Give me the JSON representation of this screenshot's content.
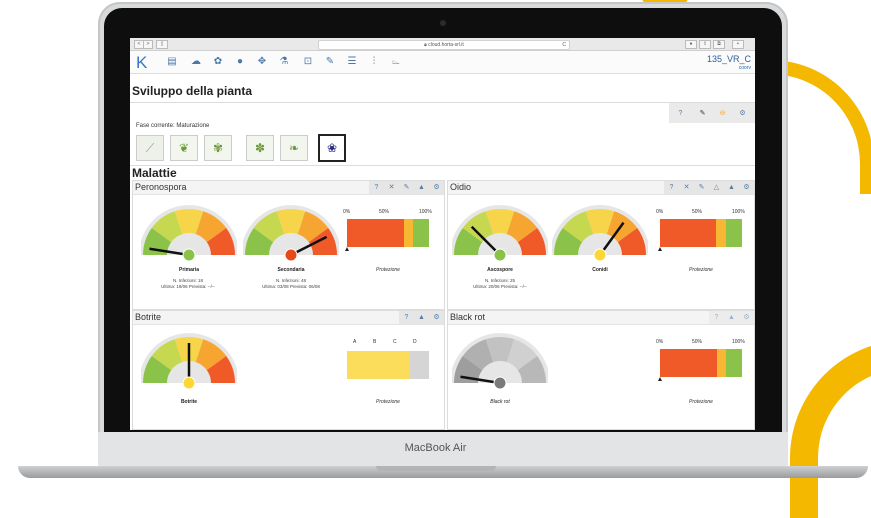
{
  "device": {
    "brand": "MacBook Air"
  },
  "browser": {
    "url": "cloud.horta-srl.it",
    "nav_back": "<",
    "nav_forward": ">",
    "sidebar": "▯",
    "reload": "C",
    "right_icons": [
      "●",
      "⇪",
      "⧉",
      "+"
    ]
  },
  "app": {
    "logo": "K",
    "title": "135_VR_C",
    "subtitle": "coorv",
    "nav_icons": [
      "document-icon",
      "cloud-icon",
      "leaf-icon",
      "bug-icon",
      "tree-icon",
      "flask-icon",
      "target-icon",
      "edit-icon",
      "list-icon",
      "sliders-icon",
      "chart-icon"
    ]
  },
  "development": {
    "title": "Sviluppo della pianta",
    "current_phase_label": "Fase corrente: Maturazione",
    "tools": [
      "?",
      "✎",
      "⊖",
      "⚙"
    ],
    "phases": [
      "bud-icon",
      "sprout-icon",
      "leaves-icon",
      "flower-icon",
      "fruitset-icon",
      "grape-icon"
    ]
  },
  "diseases": {
    "title": "Malattie",
    "peronospora": {
      "name": "Peronospora",
      "tools": [
        "?",
        "✕",
        "✎",
        "▲",
        "⚙"
      ],
      "gauges": [
        {
          "label": "Primaria",
          "level": 0.05,
          "dot": "#8bc34a",
          "info": [
            "N. Infezioni: 18",
            "Ultima: 19/06 Prevista: --/--"
          ]
        },
        {
          "label": "Secondaria",
          "level": 0.85,
          "dot": "#e64a19",
          "info": [
            "N. Infezioni: 48",
            "Ultima: 03/08 Prevista: 06/08"
          ]
        }
      ],
      "protection": {
        "ticks": [
          "0%",
          "50%",
          "100%"
        ],
        "label": "Protezione",
        "segments": [
          {
            "color": "#f05a28",
            "value": 0.7
          },
          {
            "color": "#f7b733",
            "value": 0.1
          },
          {
            "color": "#8bc34a",
            "value": 0.2
          }
        ]
      }
    },
    "oidio": {
      "name": "Oidio",
      "tools": [
        "?",
        "✕",
        "✎",
        "△",
        "▲",
        "⚙"
      ],
      "gauges": [
        {
          "label": "Ascospore",
          "level": 0.25,
          "dot": "#8bc34a",
          "info": [
            "N. Infezioni: 25",
            "Ultima: 20/06 Prevista: --/--"
          ]
        },
        {
          "label": "Conidi",
          "level": 0.7,
          "dot": "#fdd835",
          "info": []
        }
      ],
      "protection": {
        "ticks": [
          "0%",
          "50%",
          "100%"
        ],
        "label": "Protezione",
        "segments": [
          {
            "color": "#f05a28",
            "value": 0.68
          },
          {
            "color": "#f7b733",
            "value": 0.12
          },
          {
            "color": "#8bc34a",
            "value": 0.2
          }
        ]
      }
    },
    "botrite": {
      "name": "Botrite",
      "tools": [
        "?",
        "▲",
        "⚙"
      ],
      "gauge": {
        "label": "Botrite",
        "level": 0.5,
        "dot": "#fdd835"
      },
      "classes": [
        "A",
        "B",
        "C",
        "D"
      ],
      "protection": {
        "label": "Protezione",
        "segments": [
          {
            "color": "#fcdc5b",
            "value": 0.75
          },
          {
            "color": "#d5d5d5",
            "value": 0.25
          }
        ]
      }
    },
    "blackrot": {
      "name": "Black rot",
      "tools": [
        "?",
        "▲",
        "⚙"
      ],
      "gauge": {
        "label": "Black rot",
        "level": 0.05,
        "dot": "#7a7a7a",
        "grey": true
      },
      "protection": {
        "ticks": [
          "0%",
          "50%",
          "100%"
        ],
        "label": "Protezione",
        "segments": [
          {
            "color": "#f05a28",
            "value": 0.7
          },
          {
            "color": "#f7b733",
            "value": 0.1
          },
          {
            "color": "#8bc34a",
            "value": 0.2
          }
        ]
      }
    }
  },
  "colors": {
    "accent": "#3478c4",
    "gauge_green": "#8bc34a",
    "gauge_yellow": "#f7d54a",
    "gauge_orange": "#f7a531",
    "gauge_red": "#f05a28",
    "bg_arc": "#f5b800"
  }
}
